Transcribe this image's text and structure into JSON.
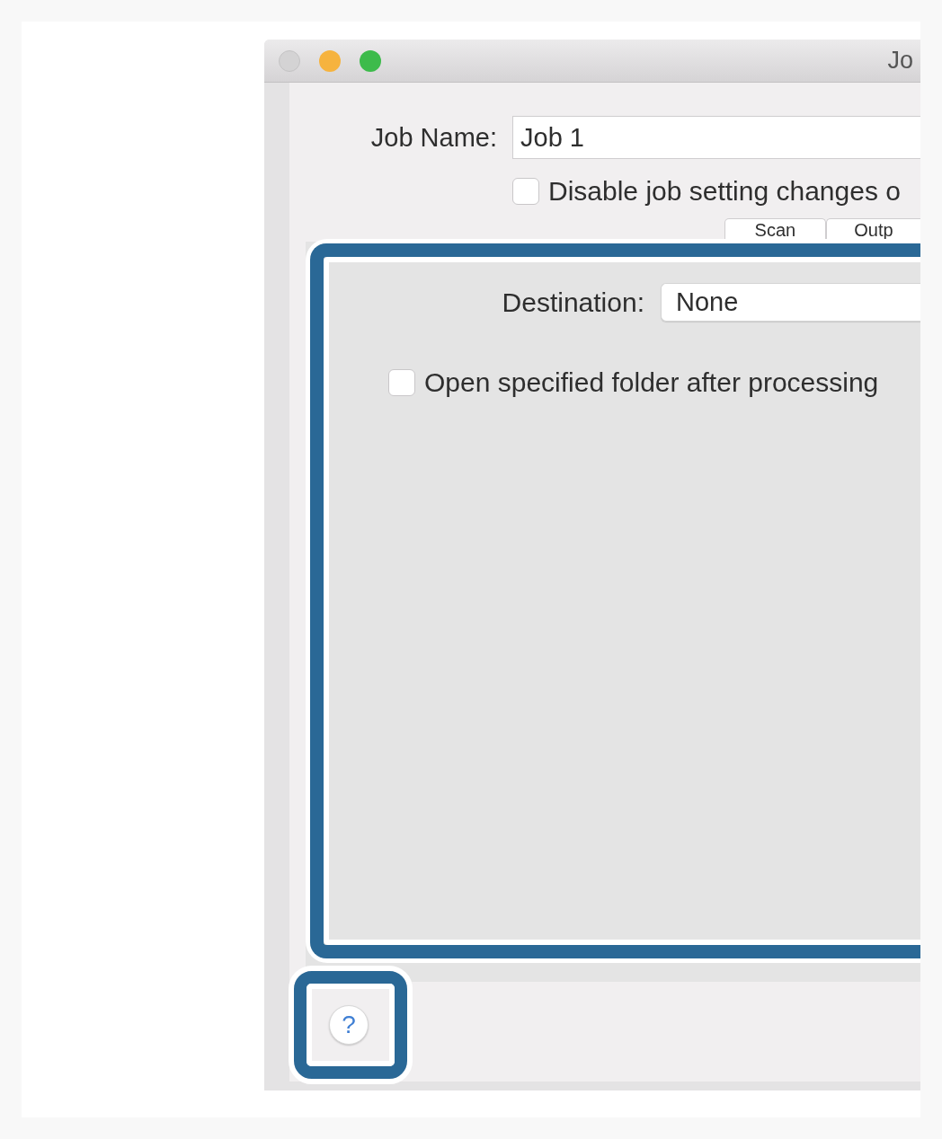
{
  "window": {
    "title": "Jo",
    "buttons": [
      {
        "kind": "close",
        "disabled": true
      },
      {
        "kind": "minimize",
        "disabled": false
      },
      {
        "kind": "zoom",
        "disabled": false
      }
    ]
  },
  "job_name": {
    "label": "Job Name:",
    "value": "Job 1"
  },
  "disable_changes": {
    "label": "Disable job setting changes o",
    "checked": false
  },
  "tabs": [
    {
      "label": "Scan",
      "selected": false
    },
    {
      "label": "Outp",
      "selected": false
    }
  ],
  "tab_panel": {
    "highlighted": true,
    "destination": {
      "label": "Destination:",
      "value": "None"
    },
    "open_folder": {
      "label": "Open specified folder after processing",
      "checked": false
    }
  },
  "help_button": {
    "label": "?",
    "highlighted": true
  }
}
